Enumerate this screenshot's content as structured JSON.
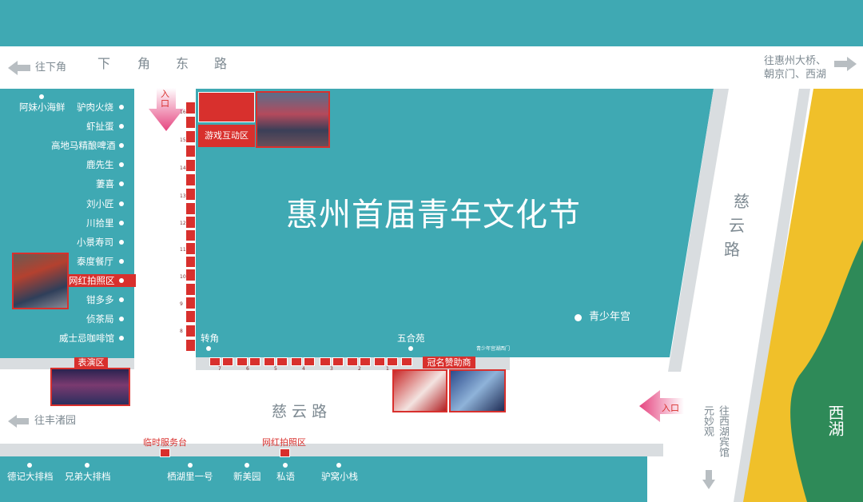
{
  "title": "惠州首届青年文化节",
  "roads": {
    "top": [
      "下",
      "角",
      "东",
      "路"
    ],
    "middle": "慈 云 路",
    "right": [
      "慈",
      "云",
      "路"
    ]
  },
  "directions": {
    "top_left": "往下角",
    "top_right_line1": "往惠州大桥、",
    "top_right_line2": "朝京门、西湖",
    "mid_left": "往丰渚园",
    "bottom_right_col1": "往西湖宾馆",
    "bottom_right_col2": "元妙观"
  },
  "entrances": {
    "top": "入口",
    "right": "入口"
  },
  "lake": "西湖",
  "zones": {
    "game": "游戏互动区",
    "performance": "表演区",
    "sponsor": "冠名赞助商",
    "service": "临时服务台",
    "photo_bottom": "网红拍照区",
    "photo_left": "网红拍照区"
  },
  "left_shops": [
    "阿妹小海鲜",
    "驴肉火烧",
    "虾扯蛋",
    "高地马精酿啤酒",
    "鹿先生",
    "萋喜",
    "刘小匠",
    "川拾里",
    "小景寿司",
    "泰度餐厅",
    "钳多多",
    "侦茶局",
    "威士忌咖啡馆"
  ],
  "landmarks": {
    "corner": "转角",
    "wuheyuan": "五合苑",
    "youth_palace": "青少年宫",
    "youth_palace_gate": "青少年宫湖西门"
  },
  "bottom_shops": [
    "德记大排档",
    "兄弟大排档",
    "栖湖里一号",
    "新美园",
    "私语",
    "驴窝小栈"
  ],
  "booth_numbers_vertical": [
    "16",
    "15",
    "14",
    "13",
    "12",
    "11",
    "10",
    "9",
    "8"
  ],
  "booth_numbers_horizontal": [
    "7",
    "6",
    "5",
    "4",
    "3",
    "2",
    "1"
  ],
  "colors": {
    "teal": "#3fa9b3",
    "red": "#d8302d",
    "yellow": "#f0c02a",
    "green": "#2e8a58",
    "pink": "#e5447f"
  }
}
